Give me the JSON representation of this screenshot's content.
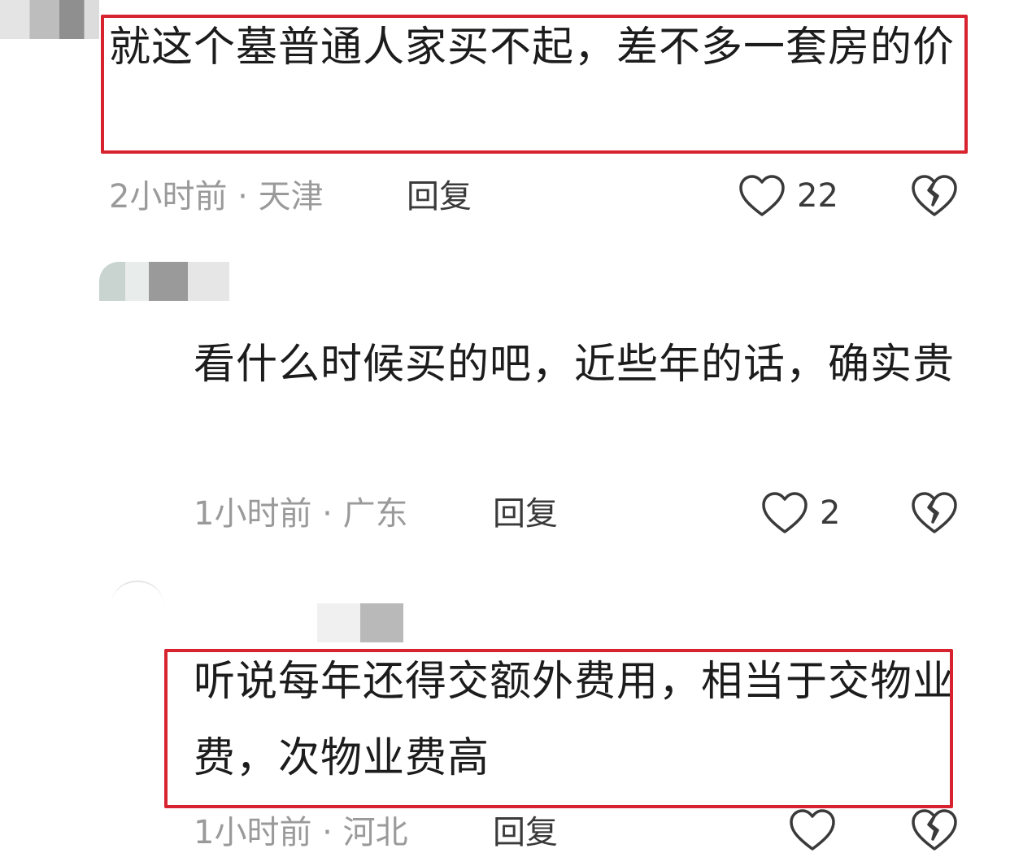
{
  "comments": [
    {
      "text": "就这个墓普通人家买不起，差不多一套房的价",
      "time_location": "2小时前 · 天津",
      "reply_label": "回复",
      "likes": "22"
    },
    {
      "text": "看什么时候买的吧，近些年的话，确实贵",
      "time_location": "1小时前 · 广东",
      "reply_label": "回复",
      "likes": "2"
    },
    {
      "text": "听说每年还得交额外费用，相当于交物业费，次物业费高",
      "time_location": "1小时前 · 河北",
      "reply_label": "回复",
      "likes": ""
    }
  ],
  "colors": {
    "highlight_box": "#d7232f",
    "meta_text": "#9a9a9a",
    "body_text": "#1c1c1c"
  },
  "icons": [
    "heart-outline-icon",
    "broken-heart-icon"
  ]
}
